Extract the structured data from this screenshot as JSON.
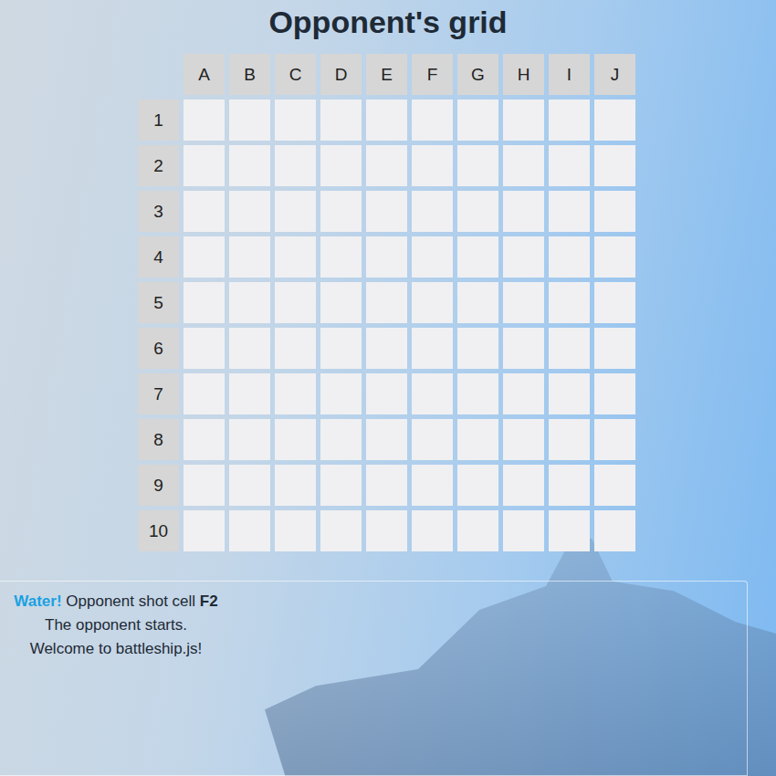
{
  "title": "Opponent's grid",
  "grid": {
    "columns": [
      "A",
      "B",
      "C",
      "D",
      "E",
      "F",
      "G",
      "H",
      "I",
      "J"
    ],
    "rows": [
      "1",
      "2",
      "3",
      "4",
      "5",
      "6",
      "7",
      "8",
      "9",
      "10"
    ]
  },
  "log": [
    {
      "tag": "Water!",
      "color": "#1ba1e2",
      "text": "Opponent shot cell",
      "cell": "F2"
    },
    {
      "tag": "",
      "color": "#1e2a36",
      "text": "The opponent starts.",
      "cell": ""
    },
    {
      "tag": "",
      "color": "#1e2a36",
      "text": "Welcome to battleship.js!",
      "cell": ""
    }
  ]
}
